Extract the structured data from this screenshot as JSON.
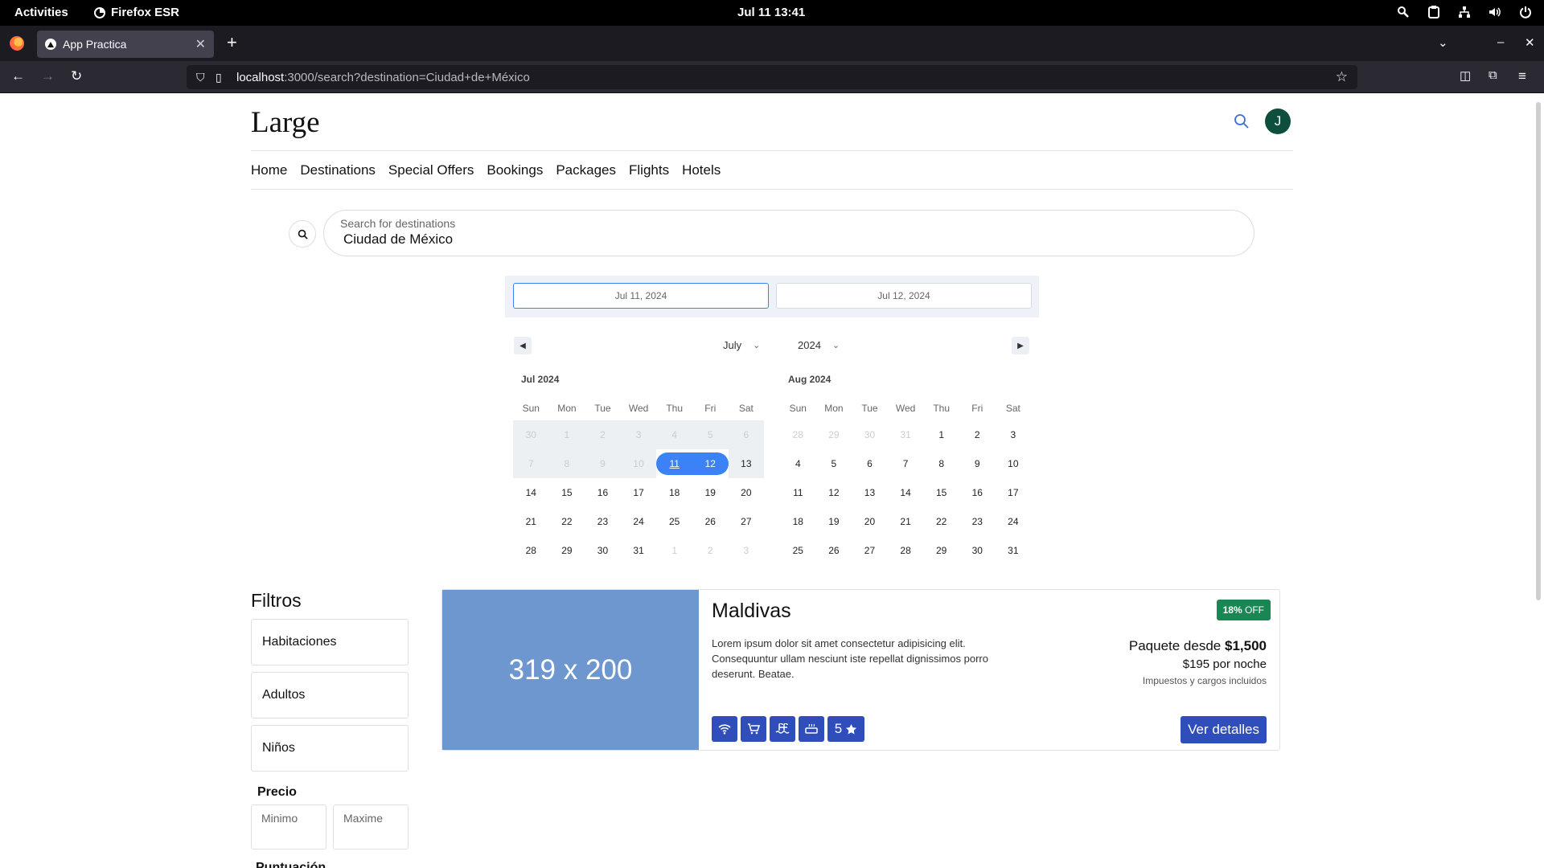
{
  "system": {
    "activities": "Activities",
    "app_name": "Firefox ESR",
    "clock": "Jul 11  13:41"
  },
  "browser": {
    "tab_title": "App Practica",
    "url_host": "localhost",
    "url_rest": ":3000/search?destination=Ciudad+de+México"
  },
  "site": {
    "brand": "Large",
    "avatar_initial": "J",
    "nav": [
      "Home",
      "Destinations",
      "Special Offers",
      "Bookings",
      "Packages",
      "Flights",
      "Hotels"
    ]
  },
  "search": {
    "placeholder": "Search for destinations",
    "value": "Ciudad de México"
  },
  "datepicker": {
    "start": "Jul 11, 2024",
    "end": "Jul 12, 2024",
    "month_select": "July",
    "year_select": "2024",
    "weekdays": [
      "Sun",
      "Mon",
      "Tue",
      "Wed",
      "Thu",
      "Fri",
      "Sat"
    ],
    "months": [
      {
        "title": "Jul 2024",
        "days": [
          "30",
          "1",
          "2",
          "3",
          "4",
          "5",
          "6",
          "7",
          "8",
          "9",
          "10",
          "11",
          "12",
          "13",
          "14",
          "15",
          "16",
          "17",
          "18",
          "19",
          "20",
          "21",
          "22",
          "23",
          "24",
          "25",
          "26",
          "27",
          "28",
          "29",
          "30",
          "31",
          "1",
          "2",
          "3"
        ]
      },
      {
        "title": "Aug 2024",
        "days": [
          "28",
          "29",
          "30",
          "31",
          "1",
          "2",
          "3",
          "4",
          "5",
          "6",
          "7",
          "8",
          "9",
          "10",
          "11",
          "12",
          "13",
          "14",
          "15",
          "16",
          "17",
          "18",
          "19",
          "20",
          "21",
          "22",
          "23",
          "24",
          "25",
          "26",
          "27",
          "28",
          "29",
          "30",
          "31"
        ]
      }
    ]
  },
  "filters": {
    "title": "Filtros",
    "rooms": "Habitaciones",
    "adults": "Adultos",
    "children": "Niños",
    "price_label": "Precio",
    "min_placeholder": "Minimo",
    "max_placeholder": "Maxime",
    "next_section": "Puntuación"
  },
  "result": {
    "image_text": "319 x 200",
    "title": "Maldivas",
    "description": "Lorem ipsum dolor sit amet consectetur adipisicing elit. Consequuntur ullam nesciunt iste repellat dignissimos porro deserunt. Beatae.",
    "discount_pct": "18%",
    "discount_word": "OFF",
    "package_prefix": "Paquete desde",
    "package_price": "$1,500",
    "per_night": "$195 por noche",
    "taxes": "Impuestos y cargos incluidos",
    "rating": "5",
    "amenities": [
      "wifi-icon",
      "cart-icon",
      "pool-icon",
      "sauna-icon"
    ],
    "details_button": "Ver detalles"
  }
}
